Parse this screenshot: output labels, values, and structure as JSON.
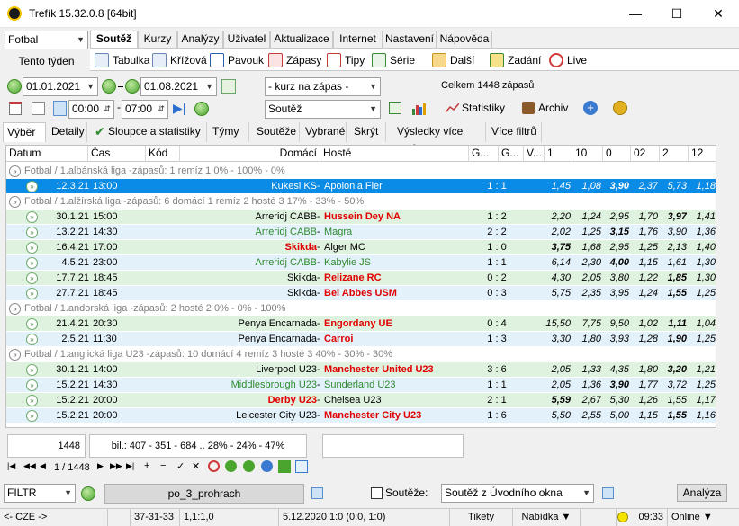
{
  "window": {
    "title": "Trefík 15.32.0.8 [64bit]"
  },
  "left": {
    "sport": "Fotbal",
    "week_button": "Tento týden"
  },
  "tabs": [
    "Soutěž",
    "Kurzy",
    "Analýzy",
    "Uživatel",
    "Aktualizace",
    "Internet",
    "Nastavení",
    "Nápověda"
  ],
  "toolbar": [
    "Tabulka",
    "Křížová",
    "Pavouk",
    "Zápasy",
    "Tipy",
    "Série",
    "Další",
    "Zadání",
    "Live"
  ],
  "filter": {
    "date_from": "01.01.2021",
    "date_to": "01.08.2021",
    "odds_filter": "- kurz na zápas -",
    "total": "Celkem 1448 zápasů",
    "time_from": "00:00",
    "time_to": "07:00",
    "competition": "Soutěž",
    "stats_button": "Statistiky",
    "archive_button": "Archiv"
  },
  "subtabs": [
    "Výběr",
    "Detaily",
    "Sloupce a statistiky",
    "Týmy",
    "Soutěže",
    "Vybrané",
    "Skrýt",
    "Výsledky více filtrů",
    "Více filtrů"
  ],
  "columns": [
    "Datum",
    "Čas",
    "Kód",
    "Domácí",
    "Hosté",
    "G...",
    "G...",
    "V...",
    "1",
    "10",
    "0",
    "02",
    "2",
    "12"
  ],
  "groups": [
    {
      "label": "Fotbal / 1.albánská liga -zápasů: 1   remíz 1      0% - 100% - 0%",
      "rows": [
        {
          "date": "12.3.21",
          "time": "13:00",
          "home": "Kukesi KS",
          "away": "Apolonia Fier",
          "score": "1 : 1",
          "odds": [
            "1,45",
            "1,08",
            "3,90",
            "2,37",
            "5,73",
            "1,18"
          ],
          "sel": true,
          "hc": "",
          "ac": "",
          "bold": [
            2
          ]
        }
      ]
    },
    {
      "label": "Fotbal / 1.alžírská liga -zápasů: 6  domácí 1  remíz 2  hosté 3      17% - 33% - 50%",
      "rows": [
        {
          "date": "30.1.21",
          "time": "15:00",
          "home": "Arreridj CABB",
          "away": "Hussein Dey NA",
          "score": "1 : 2",
          "odds": [
            "2,20",
            "1,24",
            "2,95",
            "1,70",
            "3,97",
            "1,41"
          ],
          "hc": "",
          "ac": "away-red",
          "bold": [
            4
          ]
        },
        {
          "date": "13.2.21",
          "time": "14:30",
          "home": "Arreridj CABB",
          "away": "Magra",
          "score": "2 : 2",
          "odds": [
            "2,02",
            "1,25",
            "3,15",
            "1,76",
            "3,90",
            "1,36"
          ],
          "hc": "home-green",
          "ac": "away-green",
          "bold": [
            2
          ]
        },
        {
          "date": "16.4.21",
          "time": "17:00",
          "home": "Skikda",
          "away": "Alger MC",
          "score": "1 : 0",
          "odds": [
            "3,75",
            "1,68",
            "2,95",
            "1,25",
            "2,13",
            "1,40"
          ],
          "hc": "home-red",
          "ac": "",
          "bold": [
            0
          ]
        },
        {
          "date": "4.5.21",
          "time": "23:00",
          "home": "Arreridj CABB",
          "away": "Kabylie JS",
          "score": "1 : 1",
          "odds": [
            "6,14",
            "2,30",
            "4,00",
            "1,15",
            "1,61",
            "1,30"
          ],
          "hc": "home-green",
          "ac": "away-green",
          "bold": [
            2
          ]
        },
        {
          "date": "17.7.21",
          "time": "18:45",
          "home": "Skikda",
          "away": "Relizane RC",
          "score": "0 : 2",
          "odds": [
            "4,30",
            "2,05",
            "3,80",
            "1,22",
            "1,85",
            "1,30"
          ],
          "hc": "",
          "ac": "away-red",
          "bold": [
            4
          ]
        },
        {
          "date": "27.7.21",
          "time": "18:45",
          "home": "Skikda",
          "away": "Bel Abbes USM",
          "score": "0 : 3",
          "odds": [
            "5,75",
            "2,35",
            "3,95",
            "1,24",
            "1,55",
            "1,25"
          ],
          "hc": "",
          "ac": "away-red",
          "bold": [
            4
          ]
        }
      ]
    },
    {
      "label": "Fotbal / 1.andorská liga -zápasů: 2     hosté 2      0% - 0% - 100%",
      "rows": [
        {
          "date": "21.4.21",
          "time": "20:30",
          "home": "Penya Encarnada",
          "away": "Engordany UE",
          "score": "0 : 4",
          "odds": [
            "15,50",
            "7,75",
            "9,50",
            "1,02",
            "1,11",
            "1,04"
          ],
          "hc": "",
          "ac": "away-red",
          "bold": [
            4
          ]
        },
        {
          "date": "2.5.21",
          "time": "11:30",
          "home": "Penya Encarnada",
          "away": "Carroi",
          "score": "1 : 3",
          "odds": [
            "3,30",
            "1,80",
            "3,93",
            "1,28",
            "1,90",
            "1,25"
          ],
          "hc": "",
          "ac": "away-red",
          "bold": [
            4
          ]
        }
      ]
    },
    {
      "label": "Fotbal / 1.anglická liga U23 -zápasů: 10  domácí 4  remíz 3  hosté 3      40% - 30% - 30%",
      "rows": [
        {
          "date": "30.1.21",
          "time": "14:00",
          "home": "Liverpool U23",
          "away": "Manchester United U23",
          "score": "3 : 6",
          "odds": [
            "2,05",
            "1,33",
            "4,35",
            "1,80",
            "3,20",
            "1,21"
          ],
          "hc": "",
          "ac": "away-red",
          "bold": [
            4
          ]
        },
        {
          "date": "15.2.21",
          "time": "14:30",
          "home": "Middlesbrough U23",
          "away": "Sunderland U23",
          "score": "1 : 1",
          "odds": [
            "2,05",
            "1,36",
            "3,90",
            "1,77",
            "3,72",
            "1,25"
          ],
          "hc": "home-green",
          "ac": "away-green",
          "bold": [
            2
          ]
        },
        {
          "date": "15.2.21",
          "time": "20:00",
          "home": "Derby U23",
          "away": "Chelsea U23",
          "score": "2 : 1",
          "odds": [
            "5,59",
            "2,67",
            "5,30",
            "1,26",
            "1,55",
            "1,17"
          ],
          "hc": "home-red",
          "ac": "",
          "bold": [
            0
          ]
        },
        {
          "date": "15.2.21",
          "time": "20:00",
          "home": "Leicester City U23",
          "away": "Manchester City U23",
          "score": "1 : 6",
          "odds": [
            "5,50",
            "2,55",
            "5,00",
            "1,15",
            "1,55",
            "1,16"
          ],
          "hc": "",
          "ac": "away-red",
          "bold": [
            4
          ]
        }
      ]
    }
  ],
  "summary": {
    "count": "1448",
    "stats": "bil.: 407 - 351 - 684 .. 28% - 24% - 47%"
  },
  "nav": {
    "position": "1 / 1448"
  },
  "bottom": {
    "filter_label": "FILTR",
    "filter_name": "po_3_prohrach",
    "competitions_label": "Soutěže:",
    "competitions_value": "Soutěž z Úvodního okna",
    "analyze_button": "Analýza"
  },
  "status": {
    "lang": "<- CZE ->",
    "a": "37-31-33",
    "b": "1,1:1,0",
    "c": "5.12.2020 1:0 (0:0, 1:0)",
    "tickets": "Tikety",
    "offer": "Nabídka ▼",
    "time": "09:33",
    "online": "Online ▼"
  }
}
